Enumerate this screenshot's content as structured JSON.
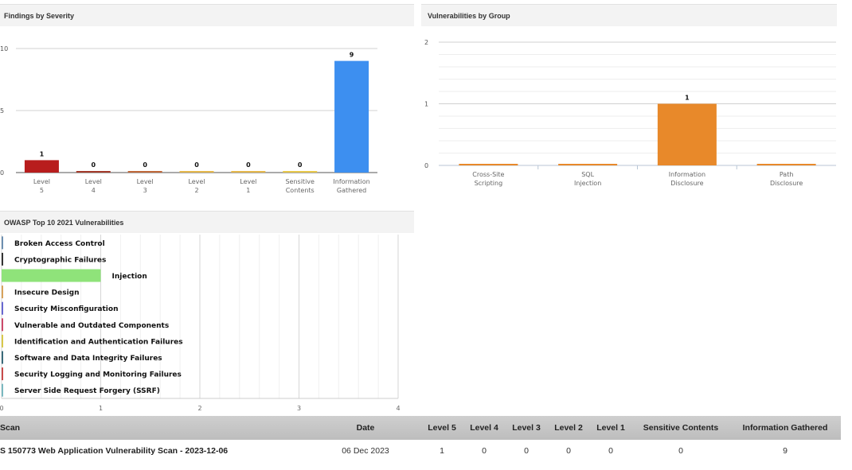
{
  "panels": {
    "severity_title": "Findings by Severity",
    "group_title": "Vulnerabilities by Group",
    "owasp_title": "OWASP Top 10 2021 Vulnerabilities"
  },
  "chart_data": [
    {
      "type": "bar",
      "title": "Findings by Severity",
      "categories": [
        [
          "Level",
          "5"
        ],
        [
          "Level",
          "4"
        ],
        [
          "Level",
          "3"
        ],
        [
          "Level",
          "2"
        ],
        [
          "Level",
          "1"
        ],
        [
          "Sensitive",
          "Contents"
        ],
        [
          "Information",
          "Gathered"
        ]
      ],
      "values": [
        1,
        0,
        0,
        0,
        0,
        0,
        9
      ],
      "colors": [
        "#b81d1d",
        "#a33a2a",
        "#c0683a",
        "#e5b84b",
        "#e5b84b",
        "#e8c84a",
        "#3d8ff0"
      ],
      "ylim": [
        0,
        10
      ],
      "yticks": [
        "0",
        "5",
        "10"
      ],
      "grid": true
    },
    {
      "type": "bar",
      "title": "Vulnerabilities by Group",
      "categories": [
        [
          "Cross-Site",
          "Scripting"
        ],
        [
          "SQL",
          "Injection"
        ],
        [
          "Information",
          "Disclosure"
        ],
        [
          "Path",
          "Disclosure"
        ]
      ],
      "values": [
        0,
        0,
        1,
        0
      ],
      "colors": [
        "#e8892a",
        "#e8892a",
        "#e8892a",
        "#e8892a"
      ],
      "ylim": [
        0,
        2
      ],
      "yticks": [
        "0",
        "1",
        "2"
      ],
      "grid": true
    },
    {
      "type": "bar",
      "orientation": "horizontal",
      "title": "OWASP Top 10 2021 Vulnerabilities",
      "categories": [
        "Broken Access Control",
        "Cryptographic Failures",
        "Injection",
        "Insecure Design",
        "Security Misconfiguration",
        "Vulnerable and Outdated Components",
        "Identification and Authentication Failures",
        "Software and Data Integrity Failures",
        "Security Logging and Monitoring Failures",
        "Server Side Request Forgery (SSRF)"
      ],
      "values": [
        0,
        0,
        1,
        0,
        0,
        0,
        0,
        0,
        0,
        0
      ],
      "colors": [
        "#6d8fb0",
        "#333333",
        "#8fe37a",
        "#d7a25c",
        "#6868d0",
        "#cc4a6a",
        "#d8c84a",
        "#3a6a7a",
        "#c84a4a",
        "#7ab8c0"
      ],
      "xlim": [
        0,
        4
      ],
      "xticks": [
        "0",
        "1",
        "2",
        "3",
        "4"
      ],
      "grid": true
    }
  ],
  "summary": {
    "headers": {
      "scan": "Scan",
      "date": "Date",
      "l5": "Level 5",
      "l4": "Level 4",
      "l3": "Level 3",
      "l2": "Level 2",
      "l1": "Level 1",
      "sensitive": "Sensitive Contents",
      "info": "Information Gathered"
    },
    "row": {
      "scan": "S 150773 Web Application Vulnerability Scan - 2023-12-06",
      "date": "06 Dec 2023",
      "l5": "1",
      "l4": "0",
      "l3": "0",
      "l2": "0",
      "l1": "0",
      "sensitive": "0",
      "info": "9"
    }
  }
}
